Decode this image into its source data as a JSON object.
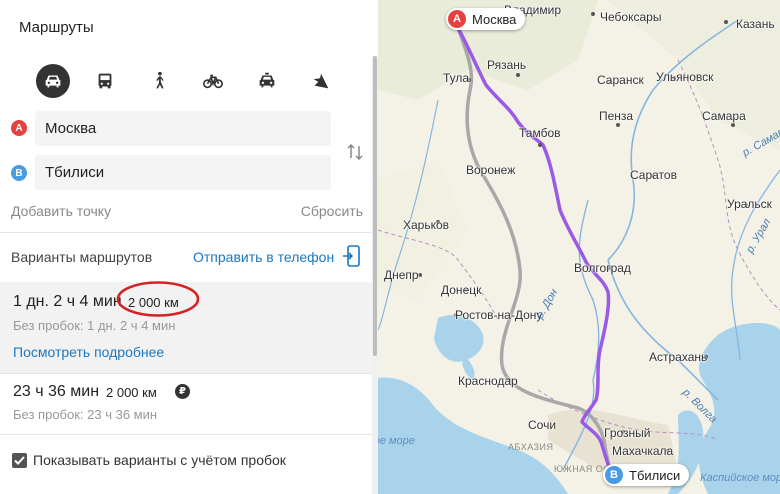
{
  "panel": {
    "title": "Маршруты",
    "transport_modes": [
      {
        "icon": "car-icon",
        "active": true
      },
      {
        "icon": "bus-icon",
        "active": false
      },
      {
        "icon": "walk-icon",
        "active": false
      },
      {
        "icon": "bicycle-icon",
        "active": false
      },
      {
        "icon": "taxi-icon",
        "active": false
      },
      {
        "icon": "plane-icon",
        "active": false
      }
    ],
    "point_a": {
      "letter": "A",
      "value": "Москва",
      "color": "#e54140"
    },
    "point_b": {
      "letter": "B",
      "value": "Тбилиси",
      "color": "#4a9be4"
    },
    "add_point": "Добавить точку",
    "reset": "Сбросить",
    "variants_label": "Варианты маршрутов",
    "send_to_phone": "Отправить в телефон",
    "routes": [
      {
        "time": "1 дн. 2 ч 4 мин",
        "distance": "2 000 км",
        "without_traffic": "Без пробок: 1 дн. 2 ч 4 мин",
        "details_link": "Посмотреть подробнее",
        "selected": true
      },
      {
        "time": "23 ч 36 мин",
        "distance": "2 000 км",
        "without_traffic": "Без пробок: 23 ч 36 мин",
        "toll_badge": "₽",
        "selected": false
      }
    ],
    "traffic_checkbox": {
      "label": "Показывать варианты с учётом пробок",
      "checked": true
    }
  },
  "map": {
    "route_colors": {
      "selected": "#9a5ae6",
      "alternative": "#a8a8a8"
    },
    "markers": {
      "a": {
        "letter": "A",
        "label": "Москва"
      },
      "b": {
        "letter": "B",
        "label": "Тбилиси"
      }
    },
    "cities": [
      "Владимир",
      "Чебоксары",
      "Казань",
      "Рязань",
      "Тула",
      "Саранск",
      "Ульяновск",
      "Тамбов",
      "Пенза",
      "Самара",
      "Воронеж",
      "Саратов",
      "Уральск",
      "Харьков",
      "Волгоград",
      "Днепр",
      "Донецк",
      "Ростов-на-Дону",
      "Астрахань",
      "Краснодар",
      "Грозный",
      "Махачкала",
      "Сочи"
    ],
    "rivers": [
      "р. Самара",
      "р. Урал",
      "р. Дон",
      "р. Волга"
    ],
    "seas": [
      "Черное море",
      "Каспийское море"
    ],
    "regions": [
      "АБХАЗИЯ",
      "ЮЖНАЯ ОСЕТИЯ"
    ]
  }
}
